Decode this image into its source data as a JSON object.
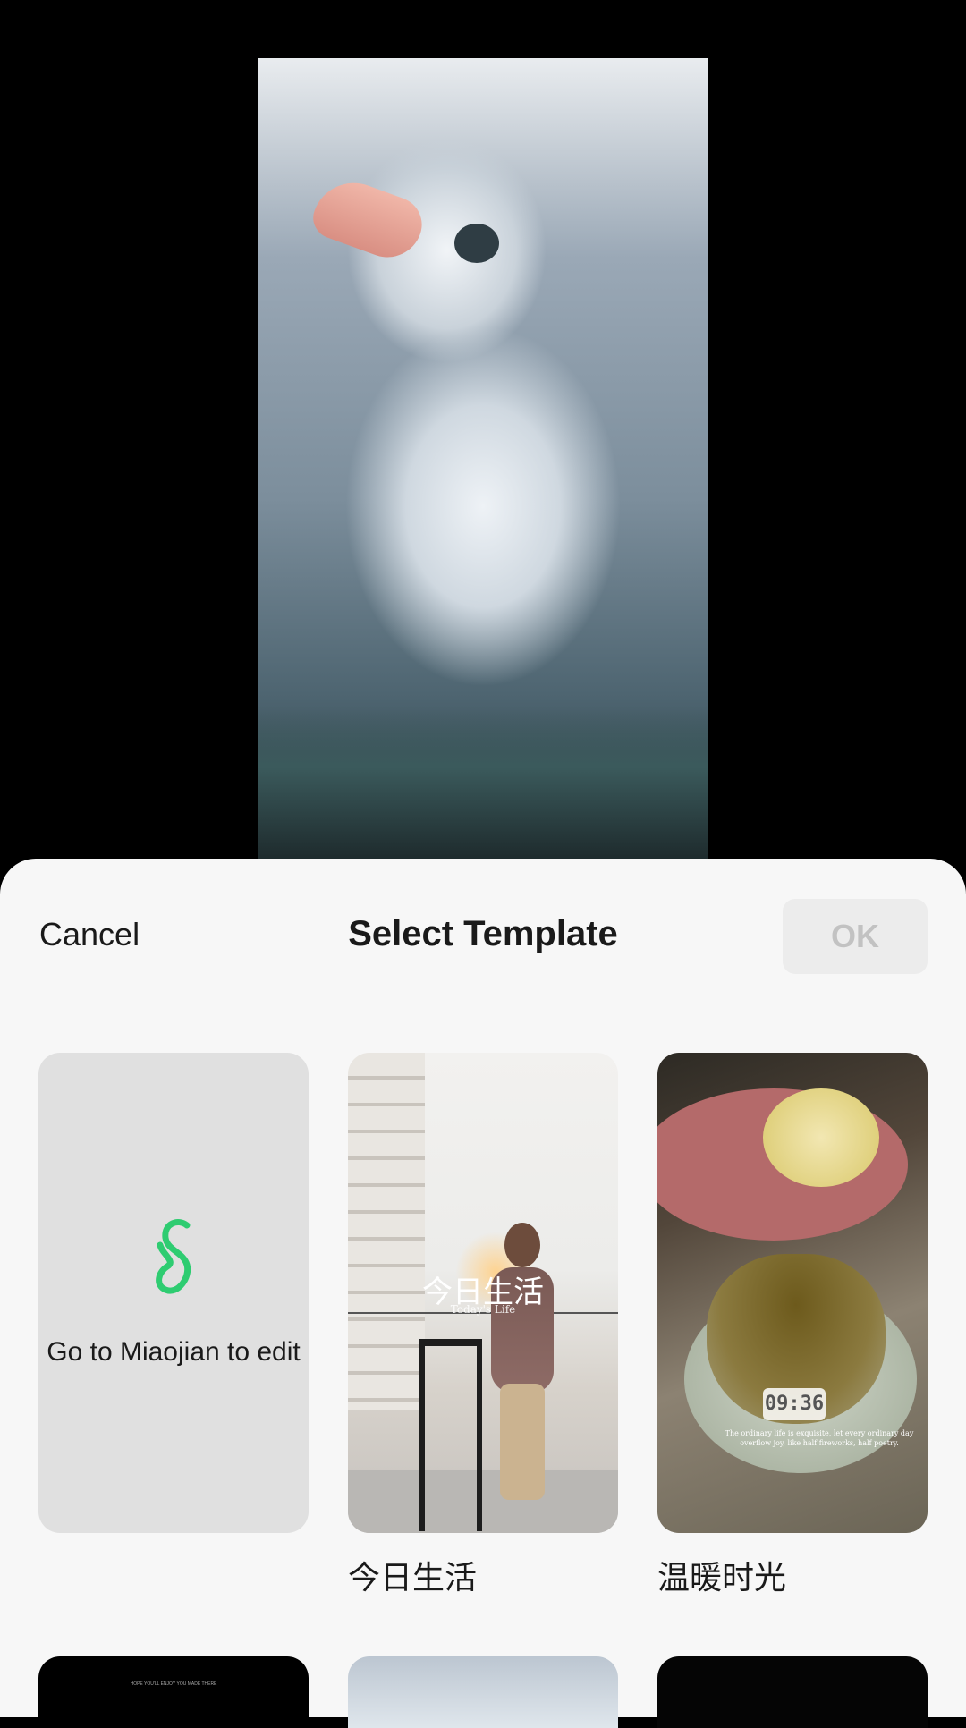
{
  "header": {
    "cancel_label": "Cancel",
    "title": "Select Template",
    "ok_label": "OK"
  },
  "templates": [
    {
      "label": "Go to Miaojian to edit",
      "icon": "miaojian-logo-icon",
      "accent": "#2ecc71"
    },
    {
      "label": "今日生活",
      "overlay_title": "今日生活",
      "overlay_subtitle": "Today's Life"
    },
    {
      "label": "温暖时光",
      "clock": "09:36",
      "caption": "The ordinary life is exquisite, let every ordinary day overflow joy, like half fireworks, half poetry."
    }
  ],
  "row2": [
    {
      "tiny_text": "HOPE YOU'LL ENJOY YOU MADE THERE"
    },
    {},
    {}
  ],
  "colors": {
    "sheet_background": "#f7f7f7",
    "ok_disabled_bg": "#ececec",
    "ok_disabled_text": "#c2c2c2",
    "accent_green": "#2ecc71"
  }
}
